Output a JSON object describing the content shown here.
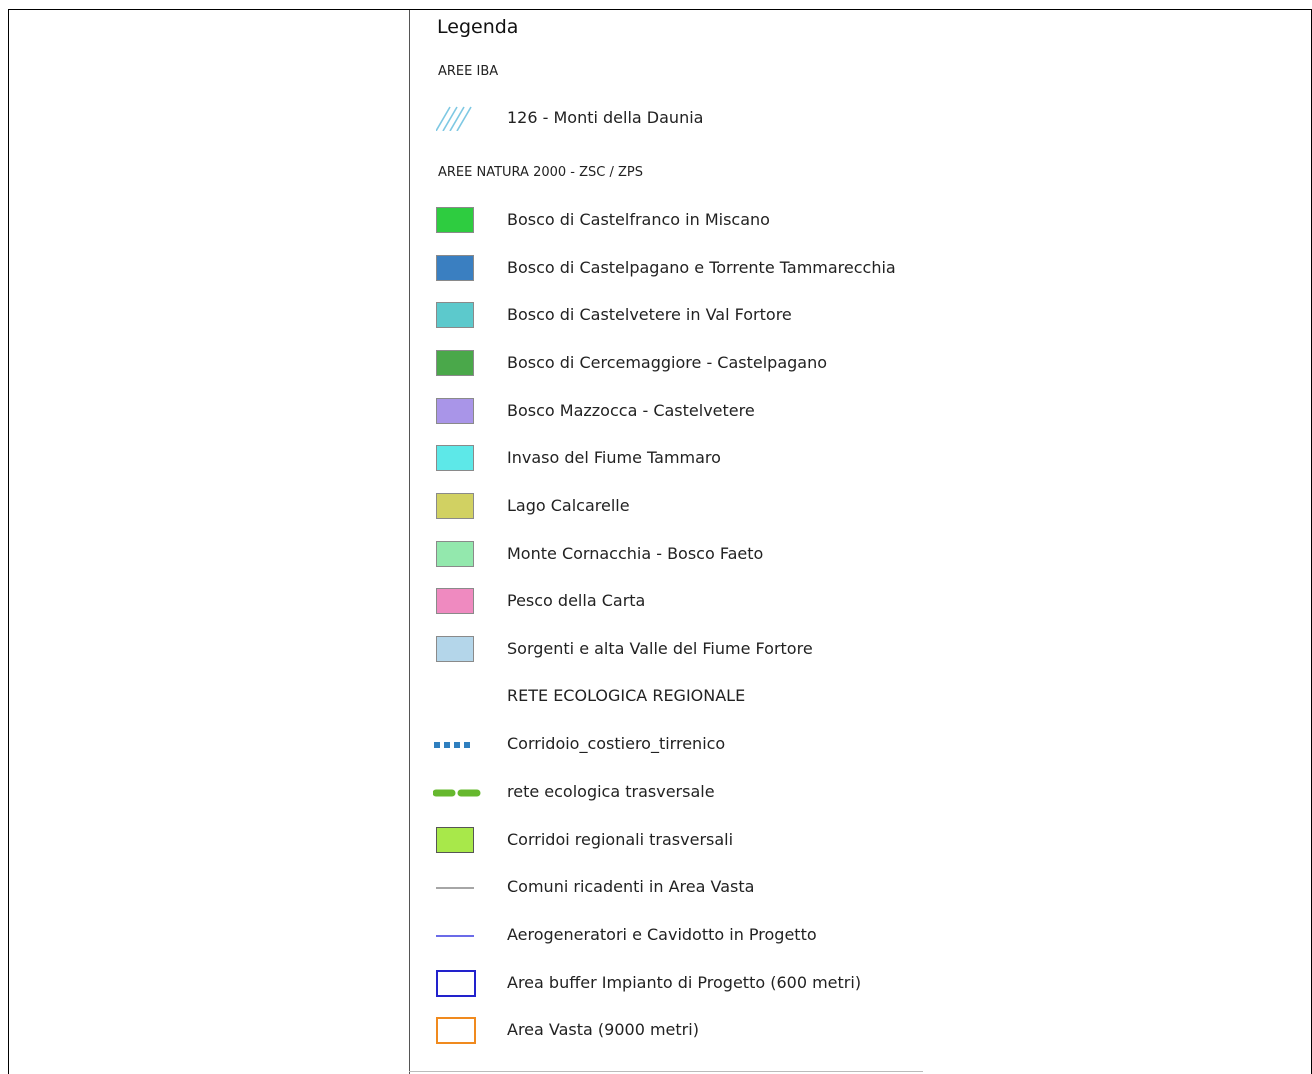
{
  "legend": {
    "title": "Legenda",
    "iba_header": "AREE IBA",
    "iba_item": {
      "label": "126 - Monti della Daunia",
      "color": "#7ec8e3",
      "icon": "diagonal-hatch-icon"
    },
    "natura_header": "AREE NATURA 2000 - ZSC / ZPS",
    "natura_items": [
      {
        "label": "Bosco di Castelfranco in Miscano",
        "color": "#2ecc40"
      },
      {
        "label": "Bosco di Castelpagano e Torrente Tammarecchia",
        "color": "#3a7fc1"
      },
      {
        "label": "Bosco di Castelvetere in Val Fortore",
        "color": "#5cc9cc"
      },
      {
        "label": "Bosco di Cercemaggiore - Castelpagano",
        "color": "#4aa84a"
      },
      {
        "label": "Bosco Mazzocca - Castelvetere",
        "color": "#a995e8"
      },
      {
        "label": "Invaso del Fiume Tammaro",
        "color": "#5de8e8"
      },
      {
        "label": "Lago Calcarelle",
        "color": "#d1d162"
      },
      {
        "label": "Monte Cornacchia - Bosco Faeto",
        "color": "#93e8ad"
      },
      {
        "label": "Pesco della Carta",
        "color": "#ef8ac0"
      },
      {
        "label": "Sorgenti e alta Valle del Fiume Fortore",
        "color": "#b4d6ea"
      }
    ],
    "rer_header": "RETE ECOLOGICA REGIONALE",
    "rer_items": [
      {
        "label": "Corridoio_costiero_tirrenico",
        "color": "#2f7fbf",
        "icon": "dotted-line-icon"
      },
      {
        "label": "rete ecologica trasversale",
        "color": "#66b82e",
        "icon": "dashed-line-icon"
      },
      {
        "label": "Corridoi regionali trasversali",
        "color": "#a8e84a",
        "icon": "fill-swatch-icon"
      },
      {
        "label": "Comuni ricadenti in Area Vasta",
        "color": "#888888",
        "icon": "thin-line-icon"
      },
      {
        "label": "Aerogeneratori e Cavidotto in Progetto",
        "color": "#3a3ae0",
        "icon": "thin-line-icon"
      },
      {
        "label": "Area buffer Impianto di Progetto (600 metri)",
        "color": "#2222cc",
        "icon": "outline-box-icon"
      },
      {
        "label": "Area Vasta (9000 metri)",
        "color": "#f08a1e",
        "icon": "outline-box-icon"
      }
    ]
  }
}
